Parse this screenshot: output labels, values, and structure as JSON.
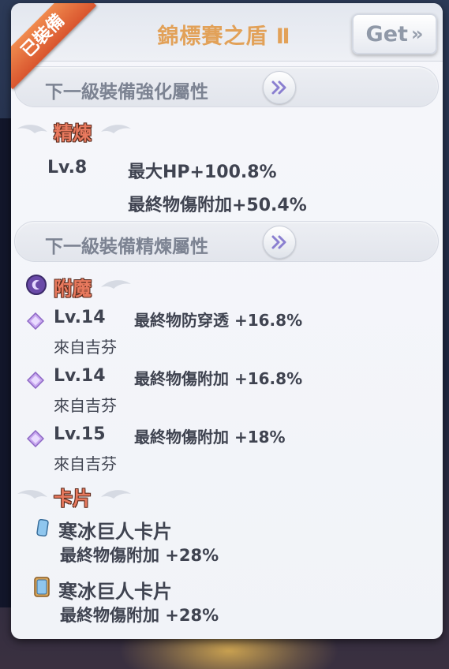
{
  "equipment": {
    "equipped_badge": "已裝備",
    "title": "錦標賽之盾 Ⅱ",
    "get_label": "Get"
  },
  "strengthen": {
    "bar_label": "下一級裝備強化屬性"
  },
  "refine": {
    "section_title": "精煉",
    "level": "Lv.8",
    "stats": [
      "最大HP+100.8%",
      "最終物傷附加+50.4%"
    ],
    "bar_label": "下一級裝備精煉屬性"
  },
  "enchant": {
    "section_title": "附魔",
    "items": [
      {
        "level": "Lv.14",
        "stat": "最終物防穿透 +16.8%",
        "source": "來自吉芬"
      },
      {
        "level": "Lv.14",
        "stat": "最終物傷附加 +16.8%",
        "source": "來自吉芬"
      },
      {
        "level": "Lv.15",
        "stat": "最終物傷附加 +18%",
        "source": "來自吉芬"
      }
    ]
  },
  "cards": {
    "section_title": "卡片",
    "items": [
      {
        "name": "寒冰巨人卡片",
        "stat": "最終物傷附加 +28%"
      },
      {
        "name": "寒冰巨人卡片",
        "stat": "最終物傷附加 +28%"
      }
    ]
  },
  "colors": {
    "title": "#e2a158",
    "badge": "#e0683a",
    "section_title": "#e8795e",
    "text": "#3f4350",
    "enchant_diamond": "#b58ee6"
  }
}
